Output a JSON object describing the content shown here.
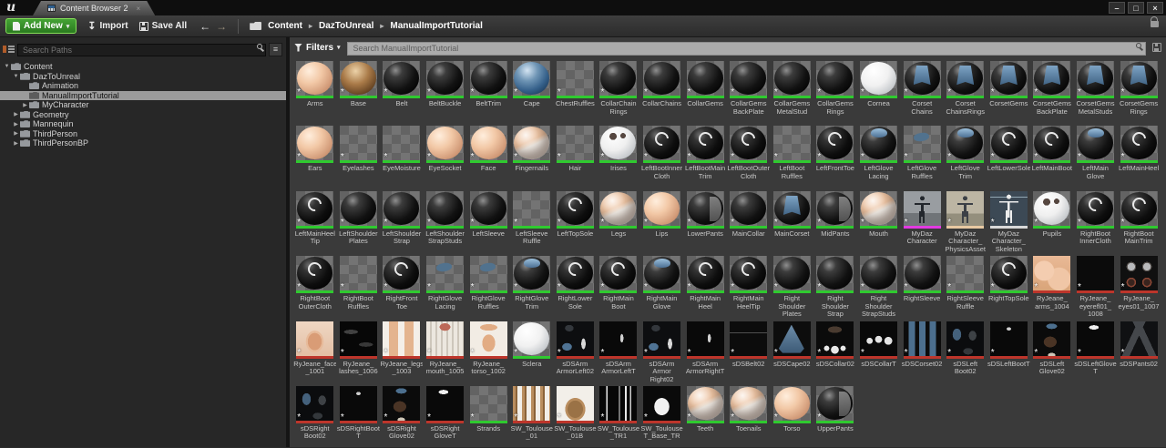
{
  "window": {
    "logo": "u",
    "tab_title": "Content Browser 2",
    "tab_close": "×",
    "buttons": {
      "minimize": "–",
      "maximize": "□",
      "close": "×"
    }
  },
  "toolbar": {
    "add_new": "Add New",
    "import": "Import",
    "save_all": "Save All",
    "breadcrumbs": [
      "Content",
      "DazToUnreal",
      "ManualImportTutorial"
    ]
  },
  "icons": {
    "caret": "▾",
    "import_arrow": "↧",
    "back": "←",
    "forward": "→",
    "crumb_sep": "▸",
    "tree_expanded": "▼",
    "tree_collapsed": "▶",
    "list": "≡",
    "star": "*"
  },
  "sidebar": {
    "search_placeholder": "Search Paths",
    "search_value": "",
    "tree": [
      {
        "label": "Content",
        "depth": 0,
        "arrow": "expanded",
        "selected": false
      },
      {
        "label": "DazToUnreal",
        "depth": 1,
        "arrow": "expanded",
        "selected": false
      },
      {
        "label": "Animation",
        "depth": 2,
        "arrow": "none",
        "selected": false
      },
      {
        "label": "ManualImportTutorial",
        "depth": 2,
        "arrow": "none",
        "selected": true
      },
      {
        "label": "MyCharacter",
        "depth": 2,
        "arrow": "collapsed",
        "selected": false
      },
      {
        "label": "Geometry",
        "depth": 1,
        "arrow": "collapsed",
        "selected": false
      },
      {
        "label": "Mannequin",
        "depth": 1,
        "arrow": "collapsed",
        "selected": false
      },
      {
        "label": "ThirdPerson",
        "depth": 1,
        "arrow": "collapsed",
        "selected": false
      },
      {
        "label": "ThirdPersonBP",
        "depth": 1,
        "arrow": "collapsed",
        "selected": false
      }
    ]
  },
  "main": {
    "filters_label": "Filters",
    "search_placeholder": "Search ManualImportTutorial",
    "search_value": ""
  },
  "asset_type_colors": {
    "material": "#2fca2f",
    "texture": "#bd352b",
    "skeletalmesh": "#e23ae2",
    "physicsasset": "#e8c9a2",
    "skeleton": "#d9d9d9"
  },
  "assets": [
    {
      "n": "Arms",
      "s": "sphere-skin",
      "c": "material"
    },
    {
      "n": "Base",
      "s": "sphere-fur",
      "c": "material"
    },
    {
      "n": "Belt",
      "s": "sphere-black",
      "c": "material"
    },
    {
      "n": "BeltBuckle",
      "s": "sphere-black",
      "c": "material"
    },
    {
      "n": "BeltTrim",
      "s": "sphere-black",
      "c": "material"
    },
    {
      "n": "Cape",
      "s": "sphere-blue",
      "c": "material"
    },
    {
      "n": "ChestRuffles",
      "s": "checker",
      "c": "material"
    },
    {
      "n": "CollarChain Rings",
      "s": "sphere-black",
      "c": "material"
    },
    {
      "n": "CollarChains",
      "s": "sphere-black",
      "c": "material"
    },
    {
      "n": "CollarGems",
      "s": "sphere-black",
      "c": "material"
    },
    {
      "n": "CollarGems BackPlate",
      "s": "sphere-black",
      "c": "material"
    },
    {
      "n": "CollarGems MetalStud",
      "s": "sphere-black",
      "c": "material"
    },
    {
      "n": "CollarGems Rings",
      "s": "sphere-black",
      "c": "material"
    },
    {
      "n": "Cornea",
      "s": "sphere-white",
      "c": "material"
    },
    {
      "n": "Corset Chains",
      "s": "sphere-corset",
      "c": "material"
    },
    {
      "n": "Corset ChainsRings",
      "s": "sphere-corset",
      "c": "material"
    },
    {
      "n": "CorsetGems",
      "s": "sphere-corset",
      "c": "material"
    },
    {
      "n": "CorsetGems BackPlate",
      "s": "sphere-corset",
      "c": "material"
    },
    {
      "n": "CorsetGems MetalStuds",
      "s": "sphere-corset",
      "c": "material"
    },
    {
      "n": "CorsetGems Rings",
      "s": "sphere-corset",
      "c": "material"
    },
    {
      "n": "Ears",
      "s": "sphere-skin",
      "c": "material"
    },
    {
      "n": "Eyelashes",
      "s": "checker",
      "c": "material"
    },
    {
      "n": "EyeMoisture",
      "s": "checker",
      "c": "material"
    },
    {
      "n": "EyeSocket",
      "s": "sphere-skin",
      "c": "material"
    },
    {
      "n": "Face",
      "s": "sphere-skin",
      "c": "material"
    },
    {
      "n": "Fingernails",
      "s": "sphere-skin-white",
      "c": "material"
    },
    {
      "n": "Hair",
      "s": "checker",
      "c": "material"
    },
    {
      "n": "Irises",
      "s": "sphere-white-spots",
      "c": "material"
    },
    {
      "n": "LeftBootInner Cloth",
      "s": "sphere-crescent",
      "c": "material"
    },
    {
      "n": "LeftBootMain Trim",
      "s": "sphere-crescent",
      "c": "material"
    },
    {
      "n": "LeftBootOuter Cloth",
      "s": "sphere-crescent",
      "c": "material"
    },
    {
      "n": "LeftBoot Ruffles",
      "s": "checker",
      "c": "material"
    },
    {
      "n": "LeftFrontToe",
      "s": "sphere-crescent",
      "c": "material"
    },
    {
      "n": "LeftGlove Lacing",
      "s": "sphere-bluetop",
      "c": "material"
    },
    {
      "n": "LeftGlove Ruffles",
      "s": "checker-blue",
      "c": "material"
    },
    {
      "n": "LeftGlove Trim",
      "s": "sphere-bluetop",
      "c": "material"
    },
    {
      "n": "LeftLowerSole",
      "s": "sphere-crescent",
      "c": "material"
    },
    {
      "n": "LeftMainBoot",
      "s": "sphere-crescent",
      "c": "material"
    },
    {
      "n": "LeftMain Glove",
      "s": "sphere-bluetop",
      "c": "material"
    },
    {
      "n": "LeftMainHeel",
      "s": "sphere-crescent",
      "c": "material"
    },
    {
      "n": "LeftMainHeel Tip",
      "s": "sphere-crescent",
      "c": "material"
    },
    {
      "n": "LeftShoulder Plates",
      "s": "sphere-black",
      "c": "material"
    },
    {
      "n": "LeftShoulder Strap",
      "s": "sphere-black",
      "c": "material"
    },
    {
      "n": "LeftShoulder StrapStuds",
      "s": "sphere-black",
      "c": "material"
    },
    {
      "n": "LeftSleeve",
      "s": "sphere-black",
      "c": "material"
    },
    {
      "n": "LeftSleeve Ruffle",
      "s": "checker",
      "c": "material"
    },
    {
      "n": "LeftTopSole",
      "s": "sphere-crescent",
      "c": "material"
    },
    {
      "n": "Legs",
      "s": "sphere-skin-white",
      "c": "material"
    },
    {
      "n": "Lips",
      "s": "sphere-skin",
      "c": "material"
    },
    {
      "n": "LowerPants",
      "s": "sphere-split",
      "c": "material"
    },
    {
      "n": "MainCollar",
      "s": "sphere-black",
      "c": "material"
    },
    {
      "n": "MainCorset",
      "s": "sphere-corset",
      "c": "material"
    },
    {
      "n": "MidPants",
      "s": "sphere-split",
      "c": "material"
    },
    {
      "n": "Mouth",
      "s": "sphere-skin-white",
      "c": "material"
    },
    {
      "n": "MyDaz Character",
      "s": "figure",
      "c": "skeletalmesh"
    },
    {
      "n": "MyDaz Character_ PhysicsAsset",
      "s": "figure-light",
      "c": "physicsasset"
    },
    {
      "n": "MyDaz Character_ Skeleton",
      "s": "skeleton-fig",
      "c": "skeleton"
    },
    {
      "n": "Pupils",
      "s": "sphere-white-spots",
      "c": "material"
    },
    {
      "n": "RightBoot InnerCloth",
      "s": "sphere-crescent",
      "c": "material"
    },
    {
      "n": "RightBoot MainTrim",
      "s": "sphere-crescent",
      "c": "material"
    },
    {
      "n": "RightBoot OuterCloth",
      "s": "sphere-crescent",
      "c": "material"
    },
    {
      "n": "RightBoot Ruffles",
      "s": "checker",
      "c": "material"
    },
    {
      "n": "RightFront Toe",
      "s": "sphere-crescent",
      "c": "material"
    },
    {
      "n": "RightGlove Lacing",
      "s": "checker-blue",
      "c": "material"
    },
    {
      "n": "RightGlove Ruffles",
      "s": "checker-blue",
      "c": "material"
    },
    {
      "n": "RightGlove Trim",
      "s": "sphere-bluetop",
      "c": "material"
    },
    {
      "n": "RightLower Sole",
      "s": "sphere-crescent",
      "c": "material"
    },
    {
      "n": "RightMain Boot",
      "s": "sphere-crescent",
      "c": "material"
    },
    {
      "n": "RightMain Glove",
      "s": "sphere-bluetop",
      "c": "material"
    },
    {
      "n": "RightMain Heel",
      "s": "sphere-crescent",
      "c": "material"
    },
    {
      "n": "RightMain HeelTip",
      "s": "sphere-crescent",
      "c": "material"
    },
    {
      "n": "Right Shoulder Plates",
      "s": "sphere-black",
      "c": "material"
    },
    {
      "n": "Right Shoulder Strap",
      "s": "sphere-black",
      "c": "material"
    },
    {
      "n": "Right Shoulder StrapStuds",
      "s": "sphere-black",
      "c": "material"
    },
    {
      "n": "RightSleeve",
      "s": "sphere-black",
      "c": "material"
    },
    {
      "n": "RightSleeve Ruffle",
      "s": "checker",
      "c": "material"
    },
    {
      "n": "RightTopSole",
      "s": "sphere-crescent",
      "c": "material"
    },
    {
      "n": "RyJeane_ arms_1004",
      "s": "tex-skin",
      "c": "texture"
    },
    {
      "n": "RyJeane_ eyerefl01_ 1008",
      "s": "tex-black",
      "c": "texture"
    },
    {
      "n": "RyJeane_ eyes01_1007",
      "s": "tex-eyes",
      "c": "texture"
    },
    {
      "n": "RyJeane_face _1001",
      "s": "tex-face",
      "c": "texture"
    },
    {
      "n": "RyJeane_ lashes_1006",
      "s": "tex-lashes",
      "c": "texture"
    },
    {
      "n": "RyJeane_legs _1003",
      "s": "tex-legs",
      "c": "texture"
    },
    {
      "n": "RyJeane_ mouth_1005",
      "s": "tex-mouth",
      "c": "texture"
    },
    {
      "n": "RyJeane_ torso_1002",
      "s": "tex-torso",
      "c": "texture"
    },
    {
      "n": "Sclera",
      "s": "sphere-white",
      "c": "material"
    },
    {
      "n": "sDSArm ArmorLeft02",
      "s": "tex-armor",
      "c": "texture"
    },
    {
      "n": "sDSArm ArmorLeftT",
      "s": "tex-armor-t",
      "c": "texture"
    },
    {
      "n": "sDSArm Armor Right02",
      "s": "tex-armor",
      "c": "texture"
    },
    {
      "n": "sDSArm ArmorRightT",
      "s": "tex-armor-t",
      "c": "texture"
    },
    {
      "n": "sDSBelt02",
      "s": "tex-line",
      "c": "texture"
    },
    {
      "n": "sDSCape02",
      "s": "tex-cape",
      "c": "texture"
    },
    {
      "n": "sDSCollar02",
      "s": "tex-collar",
      "c": "texture"
    },
    {
      "n": "sDSCollarT",
      "s": "tex-diamonds",
      "c": "texture"
    },
    {
      "n": "sDSCorset02",
      "s": "tex-corset",
      "c": "texture"
    },
    {
      "n": "sDSLeft Boot02",
      "s": "tex-boot",
      "c": "texture"
    },
    {
      "n": "sDSLeftBootT",
      "s": "tex-boot-t",
      "c": "texture"
    },
    {
      "n": "sDSLeft Glove02",
      "s": "tex-glove",
      "c": "texture"
    },
    {
      "n": "sDSLeftGlove T",
      "s": "tex-glove-t",
      "c": "texture"
    },
    {
      "n": "sDSPants02",
      "s": "tex-pants",
      "c": "texture"
    },
    {
      "n": "sDSRight Boot02",
      "s": "tex-boot",
      "c": "texture"
    },
    {
      "n": "sDSRightBoot T",
      "s": "tex-boot-t",
      "c": "texture"
    },
    {
      "n": "sDSRight Glove02",
      "s": "tex-glove",
      "c": "texture"
    },
    {
      "n": "sDSRight GloveT",
      "s": "tex-glove-t",
      "c": "texture"
    },
    {
      "n": "Strands",
      "s": "checker",
      "c": "material"
    },
    {
      "n": "SW_Toulouse _01",
      "s": "tex-hairstrips",
      "c": "texture"
    },
    {
      "n": "SW_Toulouse _01B",
      "s": "tex-hair",
      "c": "texture"
    },
    {
      "n": "SW_Toulouse _TR1",
      "s": "tex-blackstrips",
      "c": "texture"
    },
    {
      "n": "SW_Toulouse T_Base_TR",
      "s": "tex-whiteshape",
      "c": "texture"
    },
    {
      "n": "Teeth",
      "s": "sphere-skin-white",
      "c": "material"
    },
    {
      "n": "Toenails",
      "s": "sphere-skin-white",
      "c": "material"
    },
    {
      "n": "Torso",
      "s": "sphere-skin",
      "c": "material"
    },
    {
      "n": "UpperPants",
      "s": "sphere-split",
      "c": "material"
    }
  ]
}
